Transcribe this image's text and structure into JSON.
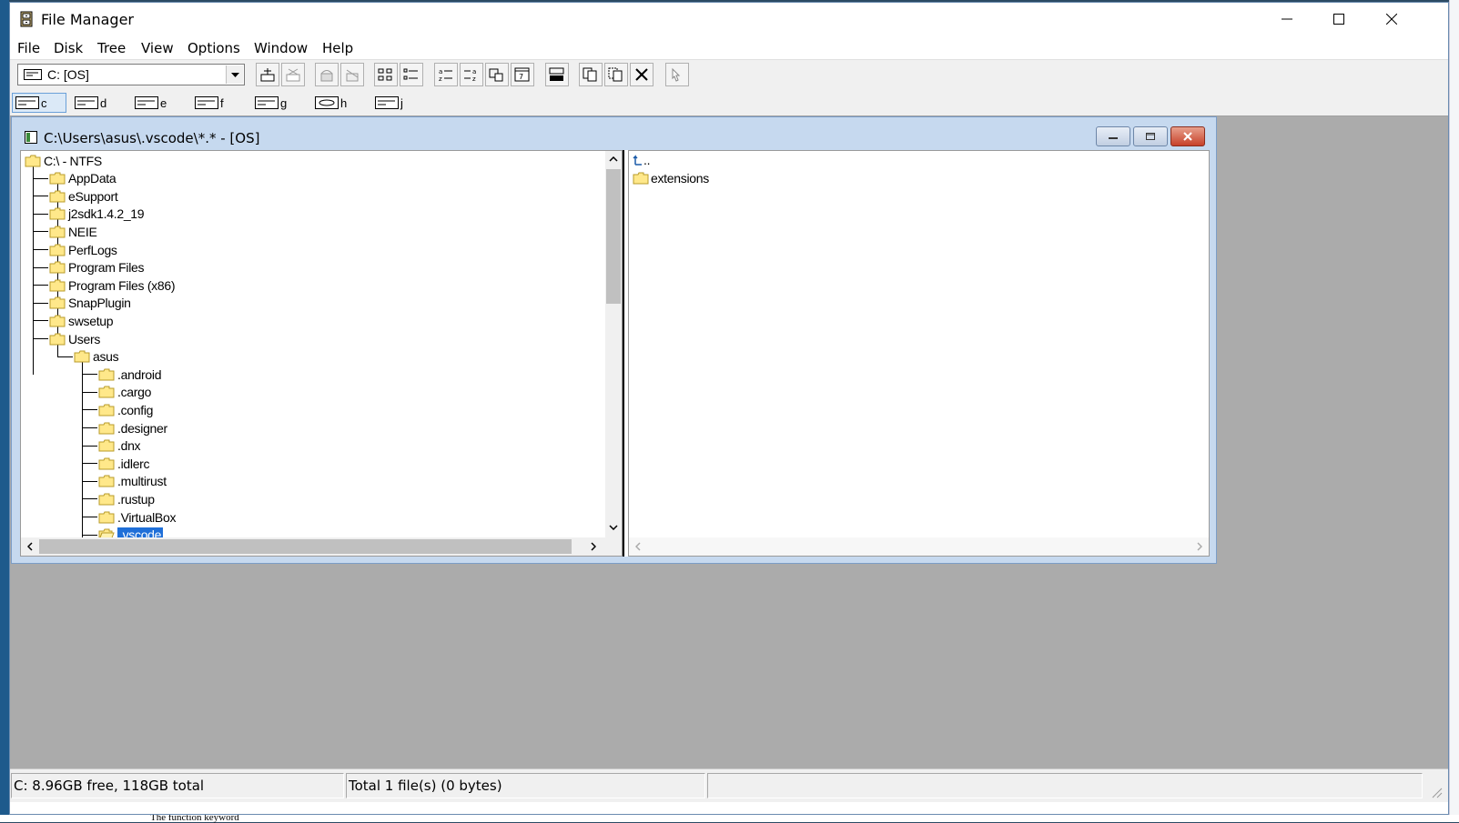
{
  "window": {
    "title": "File Manager"
  },
  "menu": [
    "File",
    "Disk",
    "Tree",
    "View",
    "Options",
    "Window",
    "Help"
  ],
  "toolbar": {
    "drive_value": "C: [OS]"
  },
  "drives": [
    "c",
    "d",
    "e",
    "f",
    "g",
    "h",
    "j"
  ],
  "child_window": {
    "title": "C:\\Users\\asus\\.vscode\\*.* - [OS]"
  },
  "tree": [
    {
      "label": "C:\\ - NTFS",
      "depth": 0
    },
    {
      "label": "AppData",
      "depth": 1
    },
    {
      "label": "eSupport",
      "depth": 1
    },
    {
      "label": "j2sdk1.4.2_19",
      "depth": 1
    },
    {
      "label": "NEIE",
      "depth": 1
    },
    {
      "label": "PerfLogs",
      "depth": 1
    },
    {
      "label": "Program Files",
      "depth": 1
    },
    {
      "label": "Program Files (x86)",
      "depth": 1
    },
    {
      "label": "SnapPlugin",
      "depth": 1
    },
    {
      "label": "swsetup",
      "depth": 1
    },
    {
      "label": "Users",
      "depth": 1
    },
    {
      "label": "asus",
      "depth": 2
    },
    {
      "label": ".android",
      "depth": 3
    },
    {
      "label": ".cargo",
      "depth": 3
    },
    {
      "label": ".config",
      "depth": 3
    },
    {
      "label": ".designer",
      "depth": 3
    },
    {
      "label": ".dnx",
      "depth": 3
    },
    {
      "label": ".idlerc",
      "depth": 3
    },
    {
      "label": ".multirust",
      "depth": 3
    },
    {
      "label": ".rustup",
      "depth": 3
    },
    {
      "label": ".VirtualBox",
      "depth": 3
    },
    {
      "label": ".vscode",
      "depth": 3,
      "selected": true
    }
  ],
  "files": [
    {
      "label": "..",
      "icon": "up-arrow-icon"
    },
    {
      "label": "extensions",
      "icon": "folder-icon"
    }
  ],
  "status": {
    "disk": "C: 8.96GB free,  118GB total",
    "files": "Total 1 file(s) (0 bytes)",
    "extra": ""
  },
  "background_text": "The function keyword",
  "colors": {
    "selection": "#1f6fd8",
    "mdi_background": "#ababab",
    "child_title": "#c6d9ef"
  }
}
